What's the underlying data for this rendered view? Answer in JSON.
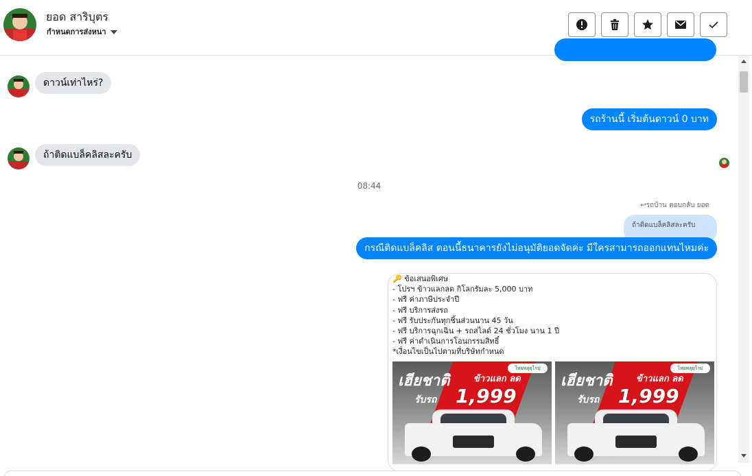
{
  "header": {
    "contact_name": "ยอด สาริบุตร",
    "contact_sub": "กำหนดการส่งหนา",
    "actions": [
      {
        "name": "report-button",
        "icon": "exclamation-icon"
      },
      {
        "name": "delete-button",
        "icon": "trash-icon"
      },
      {
        "name": "star-button",
        "icon": "star-icon"
      },
      {
        "name": "mark-unread-button",
        "icon": "envelope-icon"
      },
      {
        "name": "done-button",
        "icon": "check-icon"
      }
    ]
  },
  "messages": {
    "m1": "ดาวน์เท่าไหร่?",
    "m2": "รถร้านนี้ เริ่มต้นดาวน์ 0 บาท",
    "m3": "ถ้าติดแบล็คลิสละครับ",
    "timestamp": "08:44",
    "reply_note": "รถบ้าน ตอบกลับ ยอด",
    "reply_quote": "ถ้าติดแบล็คลิสละครับ",
    "m4": "กรณีติดแบล็คลิส ตอนนี้ธนาคารยังไม่อนุมัติยอดจัดค่ะ  มีใครสามารถออกแทนไหมค่ะ"
  },
  "promo": {
    "lines": [
      "🔑 ข้อเสนอพิเศษ",
      " - โปรฯ ข้าวแลกลด กิโลกรัมละ 5,000 บาท",
      " - ฟรี ค่าภาษีประจำปี",
      " - ฟรี บริการส่งรถ",
      " - ฟรี รับประกันทุกชิ้นส่วนนาน 45 วัน",
      " - ฟรี บริการฉุกเฉิน + รถสไลด์ 24 ชั่วโมง นาน 1 ปี",
      " - ฟรี ค่าดำเนินการโอนกรรมสิทธิ์",
      "*เงื่อนไขเป็นไปตามที่บริษัทกำหนด"
    ],
    "image_headline": "เฮียชาติ",
    "image_tagline": "ข้าวแลก ลด",
    "image_price_label": "รับรถ",
    "image_price": "1,999",
    "image_badge": "ไทยพลุยุโรป"
  },
  "colors": {
    "outgoing": "#0084ff",
    "incoming": "#e4e6eb",
    "reply_quote": "#cfe3fd"
  }
}
